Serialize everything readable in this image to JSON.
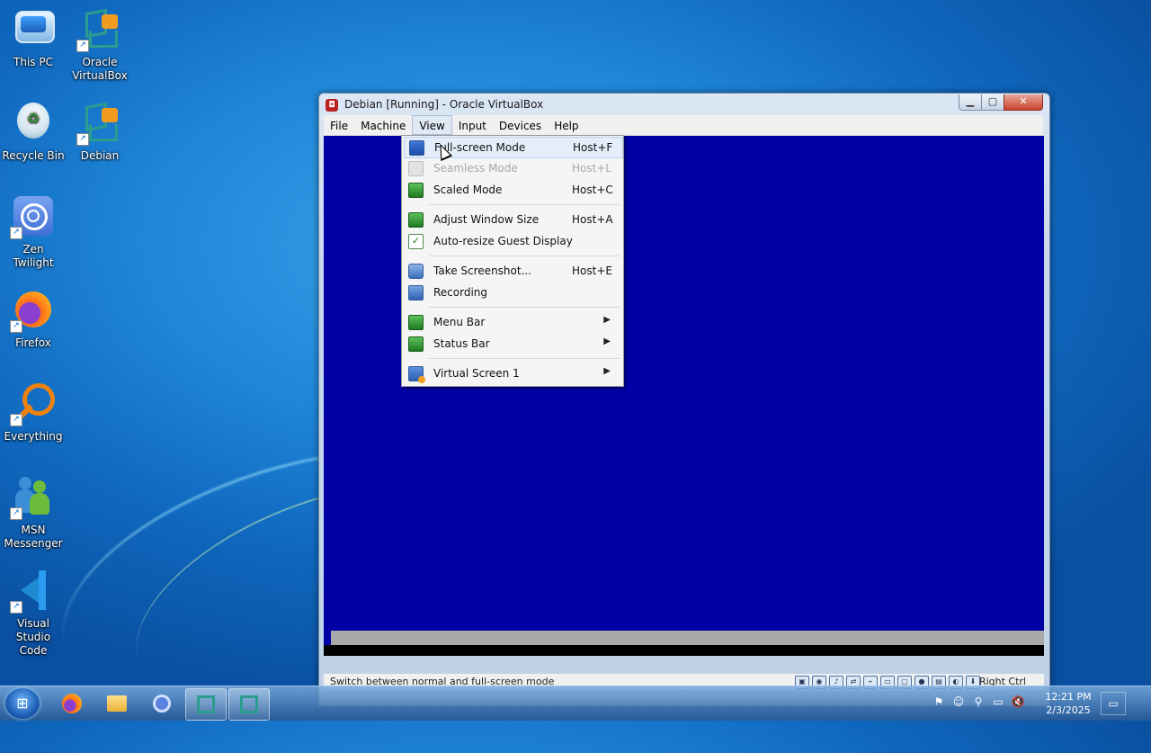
{
  "desktop": {
    "icons": [
      {
        "label": "This PC",
        "icon": "computer-icon"
      },
      {
        "label": "Oracle VirtualBox",
        "icon": "virtualbox-icon"
      },
      {
        "label": "Recycle Bin",
        "icon": "recycle-bin-icon"
      },
      {
        "label": "Debian",
        "icon": "virtualbox-icon"
      },
      {
        "label": "Zen Twilight",
        "icon": "zen-browser-icon"
      },
      {
        "label": "Firefox",
        "icon": "firefox-icon"
      },
      {
        "label": "Everything",
        "icon": "search-magnifier-icon"
      },
      {
        "label": "MSN Messenger",
        "icon": "msn-messenger-icon"
      },
      {
        "label": "Visual Studio Code",
        "icon": "vscode-icon"
      }
    ]
  },
  "window": {
    "title": "Debian [Running] - Oracle VirtualBox",
    "menu": [
      "File",
      "Machine",
      "View",
      "Input",
      "Devices",
      "Help"
    ],
    "active_menu": "View",
    "status_message": "Switch between normal and full-screen mode",
    "host_key": "Right Ctrl",
    "guest_background": "#0000a4"
  },
  "view_menu": {
    "items": [
      {
        "label": "Full-screen Mode",
        "shortcut": "Host+F",
        "state": "hover"
      },
      {
        "label": "Seamless Mode",
        "shortcut": "Host+L",
        "state": "disabled"
      },
      {
        "label": "Scaled Mode",
        "shortcut": "Host+C",
        "state": "enabled"
      },
      {
        "label": "Adjust Window Size",
        "shortcut": "Host+A",
        "state": "enabled"
      },
      {
        "label": "Auto-resize Guest Display",
        "shortcut": "",
        "state": "checked"
      },
      {
        "label": "Take Screenshot...",
        "shortcut": "Host+E",
        "state": "enabled"
      },
      {
        "label": "Recording",
        "shortcut": "",
        "state": "enabled"
      },
      {
        "label": "Menu Bar",
        "submenu": true
      },
      {
        "label": "Status Bar",
        "submenu": true
      },
      {
        "label": "Virtual Screen 1",
        "submenu": true
      }
    ]
  },
  "taskbar": {
    "clock_time": "12:21 PM",
    "clock_date": "2/3/2025",
    "apps": [
      "firefox-icon",
      "file-explorer-icon",
      "zen-browser-icon",
      "virtualbox-icon",
      "virtualbox-icon"
    ]
  }
}
